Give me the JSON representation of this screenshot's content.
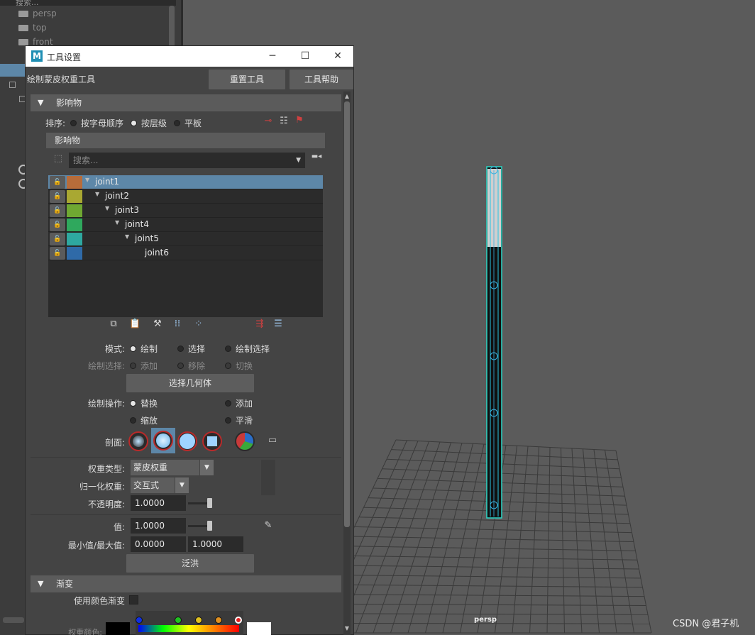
{
  "outliner": {
    "search_placeholder": "搜索...",
    "items": [
      "persp",
      "top",
      "front"
    ]
  },
  "viewport": {
    "camera_label": "persp",
    "watermark": "CSDN @君子机"
  },
  "dialog": {
    "title": "工具设置",
    "tool_name": "绘制蒙皮权重工具",
    "reset_button": "重置工具",
    "help_button": "工具帮助",
    "influences_section": "影响物",
    "sort_label": "排序:",
    "sort_options": [
      "按字母顺序",
      "按层级",
      "平板"
    ],
    "sort_selected": "按层级",
    "influences_header": "影响物",
    "search_placeholder": "搜索...",
    "joints": [
      {
        "name": "joint1",
        "color": "#b86c3a",
        "selected": true
      },
      {
        "name": "joint2",
        "color": "#a9a832",
        "selected": false
      },
      {
        "name": "joint3",
        "color": "#6fa832",
        "selected": false
      },
      {
        "name": "joint4",
        "color": "#2fa85d",
        "selected": false
      },
      {
        "name": "joint5",
        "color": "#2ea8a0",
        "selected": false
      },
      {
        "name": "joint6",
        "color": "#2f6aa8",
        "selected": false
      }
    ],
    "mode_label": "模式:",
    "mode_options": [
      "绘制",
      "选择",
      "绘制选择"
    ],
    "paint_select_label": "绘制选择:",
    "paint_select_options": [
      "添加",
      "移除",
      "切换"
    ],
    "select_geometry_button": "选择几何体",
    "paint_op_label": "绘制操作:",
    "paint_ops": [
      "替换",
      "添加",
      "缩放",
      "平滑"
    ],
    "profile_label": "剖面:",
    "weight_type_label": "权重类型:",
    "weight_type_value": "蒙皮权重",
    "normalize_label": "归一化权重:",
    "normalize_value": "交互式",
    "opacity_label": "不透明度:",
    "opacity_value": "1.0000",
    "opacity_level": 1.0,
    "value_label": "值:",
    "value_value": "1.0000",
    "value_level": 1.0,
    "minmax_label": "最小值/最大值:",
    "min_value": "0.0000",
    "max_value": "1.0000",
    "flood_button": "泛洪",
    "gradient_section": "渐变",
    "use_color_ramp_label": "使用颜色渐变",
    "weight_color_label": "权重颜色:"
  }
}
